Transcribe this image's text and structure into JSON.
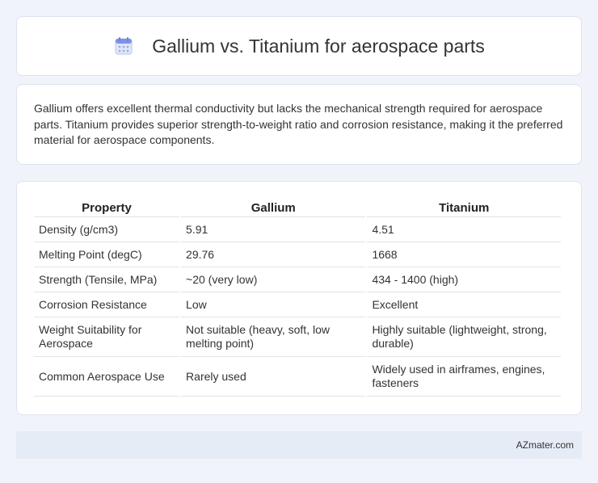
{
  "header": {
    "title": "Gallium vs. Titanium for aerospace parts",
    "icon": "calendar-icon"
  },
  "summary": {
    "text": "Gallium offers excellent thermal conductivity but lacks the mechanical strength required for aerospace parts. Titanium provides superior strength-to-weight ratio and corrosion resistance, making it the preferred material for aerospace components."
  },
  "table": {
    "headers": [
      "Property",
      "Gallium",
      "Titanium"
    ],
    "rows": [
      [
        "Density (g/cm3)",
        "5.91",
        "4.51"
      ],
      [
        "Melting Point (degC)",
        "29.76",
        "1668"
      ],
      [
        "Strength (Tensile, MPa)",
        "~20 (very low)",
        "434 - 1400 (high)"
      ],
      [
        "Corrosion Resistance",
        "Low",
        "Excellent"
      ],
      [
        "Weight Suitability for Aerospace",
        "Not suitable (heavy, soft, low melting point)",
        "Highly suitable (lightweight, strong, durable)"
      ],
      [
        "Common Aerospace Use",
        "Rarely used",
        "Widely used in airframes, engines, fasteners"
      ]
    ]
  },
  "footer": {
    "text": "AZmater.com"
  }
}
